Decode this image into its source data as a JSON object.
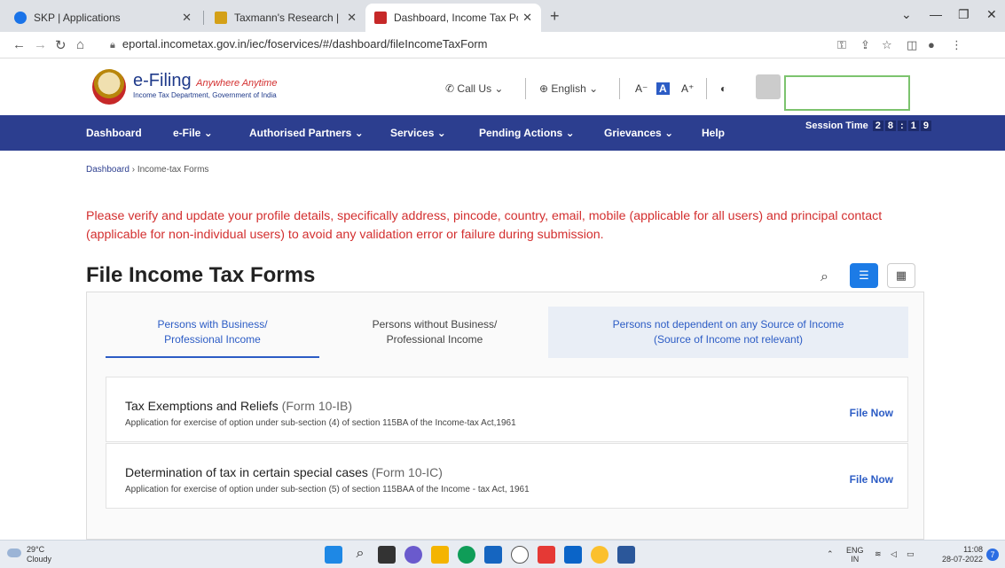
{
  "browser": {
    "tabs": [
      {
        "title": "SKP | Applications",
        "active": false,
        "favicon_color": "#1a73e8"
      },
      {
        "title": "Taxmann's Research | Income Tax",
        "active": false,
        "favicon_color": "#d4a017"
      },
      {
        "title": "Dashboard, Income Tax Portal, G",
        "active": true,
        "favicon_color": "#c62828"
      }
    ],
    "new_tab": "+",
    "url": "eportal.incometax.gov.in/iec/foservices/#/dashboard/fileIncomeTaxForm"
  },
  "header": {
    "brand": "e-Filing",
    "tagline": "Anywhere Anytime",
    "department": "Income Tax Department, Government of India",
    "call_us": "Call Us",
    "language": "English",
    "font_decrease": "A⁻",
    "font_normal": "A",
    "font_increase": "A⁺"
  },
  "nav": {
    "items": [
      "Dashboard",
      "e-File",
      "Authorised Partners",
      "Services",
      "Pending Actions",
      "Grievances",
      "Help"
    ],
    "session_label": "Session Time",
    "session_digits": [
      "2",
      "8",
      ":",
      "1",
      "9"
    ]
  },
  "breadcrumb": {
    "home": "Dashboard",
    "separator": "›",
    "current": "Income-tax Forms"
  },
  "notice": "Please verify and update your profile details, specifically address, pincode, country, email, mobile (applicable for all users) and principal contact (applicable for non-individual users) to avoid any validation error or failure during submission.",
  "page_title": "File Income Tax Forms",
  "category_tabs": [
    {
      "line1": "Persons with Business/",
      "line2": "Professional Income"
    },
    {
      "line1": "Persons without Business/",
      "line2": "Professional Income"
    },
    {
      "line1": "Persons not dependent on any Source of Income",
      "line2": "(Source of Income not relevant)"
    }
  ],
  "forms": [
    {
      "title": "Tax Exemptions and Reliefs",
      "form": "(Form 10-IB)",
      "description": "Application for exercise of option under sub-section (4) of section 115BA of the Income-tax Act,1961",
      "action": "File Now"
    },
    {
      "title": "Determination of tax in certain special cases",
      "form": "(Form 10-IC)",
      "description": "Application for exercise of option under sub-section (5) of section 115BAA of the Income - tax Act, 1961",
      "action": "File Now"
    }
  ],
  "taskbar": {
    "temperature": "29°C",
    "weather": "Cloudy",
    "language": "ENG",
    "region": "IN",
    "time": "11:08",
    "date": "28-07-2022",
    "notifications": "7"
  },
  "colors": {
    "nav_blue": "#2c3e8f",
    "accent_blue": "#2c5cc5",
    "notice_red": "#d32f2f",
    "highlight_green": "#7cc36e"
  }
}
